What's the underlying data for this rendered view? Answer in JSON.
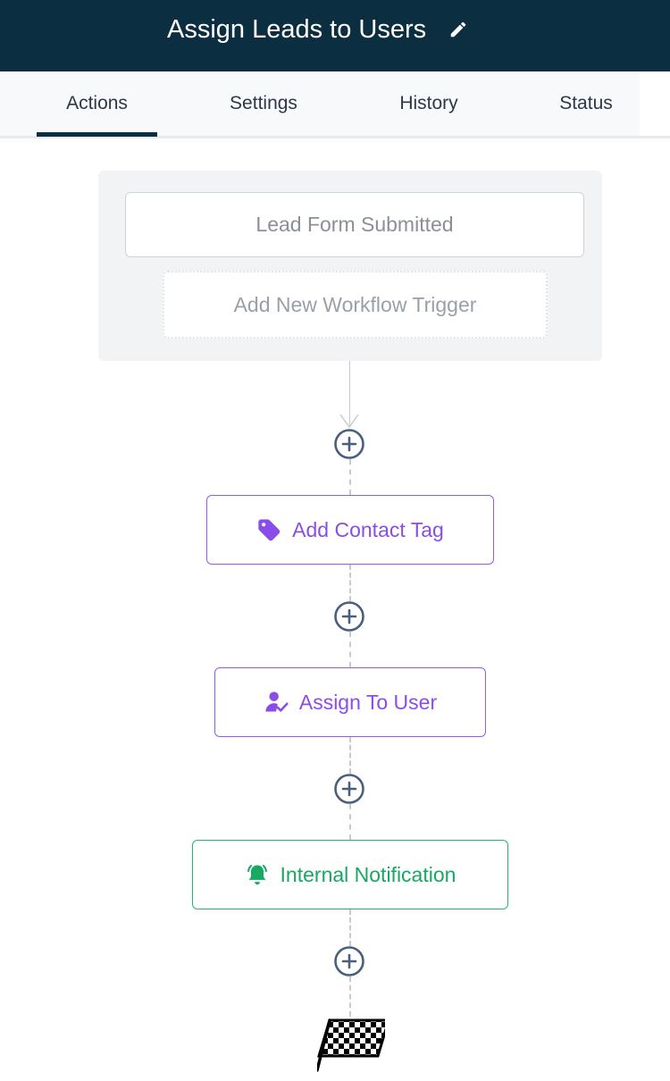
{
  "header": {
    "title": "Assign Leads to Users",
    "edit_icon": "pencil-icon"
  },
  "tabs": [
    {
      "label": "Actions",
      "active": true
    },
    {
      "label": "Settings",
      "active": false
    },
    {
      "label": "History",
      "active": false
    },
    {
      "label": "Status",
      "active": false
    }
  ],
  "triggers": {
    "items": [
      "Lead Form Submitted"
    ],
    "add_label": "Add New Workflow Trigger"
  },
  "actions": [
    {
      "label": "Add Contact Tag",
      "icon": "tag-icon",
      "color": "#8b4dea"
    },
    {
      "label": "Assign To User",
      "icon": "user-check-icon",
      "color": "#8b4dea"
    },
    {
      "label": "Internal Notification",
      "icon": "bell-icon",
      "color": "#17a862"
    }
  ],
  "icons": {
    "add_step": "plus-circle-icon",
    "end": "checkered-flag-icon"
  },
  "colors": {
    "header_bg": "#0b2e40",
    "purple": "#8b4dea",
    "green": "#17a862",
    "connector": "#c7cbd1",
    "plus": "#4a5f7d"
  }
}
